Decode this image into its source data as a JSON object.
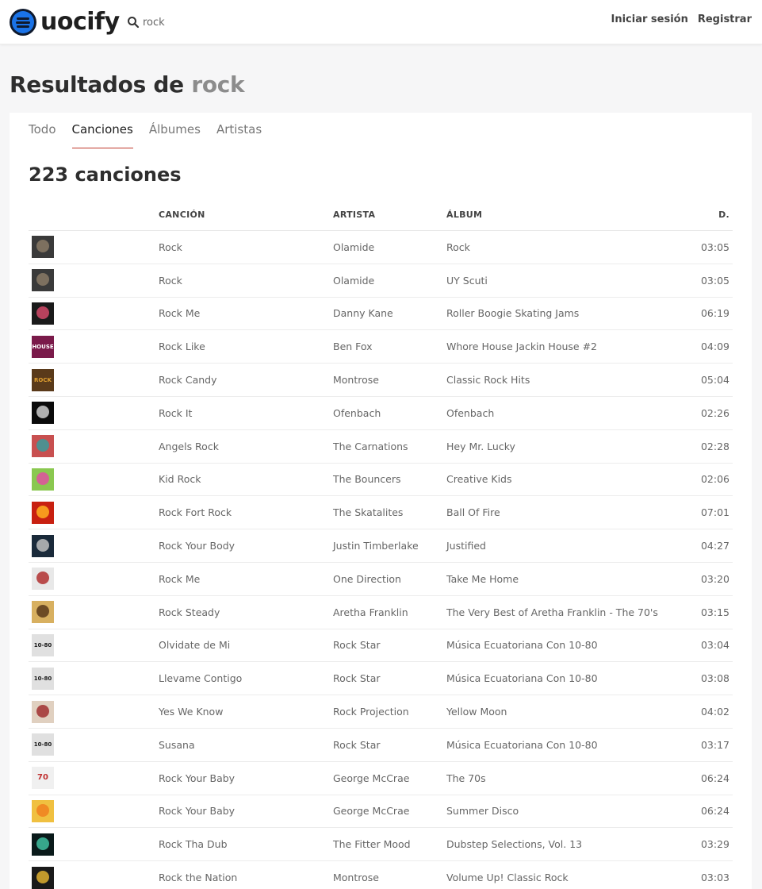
{
  "header": {
    "logo_text": "uocify",
    "search_value": "rock",
    "login_label": "Iniciar sesión",
    "register_label": "Registrar"
  },
  "page": {
    "title_prefix": "Resultados de",
    "title_query": "rock"
  },
  "tabs": [
    {
      "label": "Todo",
      "active": false
    },
    {
      "label": "Canciones",
      "active": true
    },
    {
      "label": "Álbumes",
      "active": false
    },
    {
      "label": "Artistas",
      "active": false
    }
  ],
  "results": {
    "count_label": "223 canciones",
    "columns": {
      "song": "CANCIÓN",
      "artist": "ARTISTA",
      "album": "ÁLBUM",
      "duration": "D."
    },
    "rows": [
      {
        "song": "Rock",
        "artist": "Olamide",
        "album": "Rock",
        "duration": "03:05",
        "art": {
          "bg": "#3a3a3a",
          "fg": "#8a7a66",
          "text": ""
        }
      },
      {
        "song": "Rock",
        "artist": "Olamide",
        "album": "UY Scuti",
        "duration": "03:05",
        "art": {
          "bg": "#3a3a3a",
          "fg": "#8a7a66",
          "text": ""
        }
      },
      {
        "song": "Rock Me",
        "artist": "Danny Kane",
        "album": "Roller Boogie Skating Jams",
        "duration": "06:19",
        "art": {
          "bg": "#1a1a1a",
          "fg": "#d44a6a",
          "text": ""
        }
      },
      {
        "song": "Rock Like",
        "artist": "Ben Fox",
        "album": "Whore House Jackin House #2",
        "duration": "04:09",
        "art": {
          "bg": "#7a1a4a",
          "fg": "#ffffff",
          "text": "HOUSE"
        }
      },
      {
        "song": "Rock Candy",
        "artist": "Montrose",
        "album": "Classic Rock Hits",
        "duration": "05:04",
        "art": {
          "bg": "#5a3a1a",
          "fg": "#e0a030",
          "text": "ROCK"
        }
      },
      {
        "song": "Rock It",
        "artist": "Ofenbach",
        "album": "Ofenbach",
        "duration": "02:26",
        "art": {
          "bg": "#0a0a0a",
          "fg": "#cccccc",
          "text": ""
        }
      },
      {
        "song": "Angels Rock",
        "artist": "The Carnations",
        "album": "Hey Mr. Lucky",
        "duration": "02:28",
        "art": {
          "bg": "#c85050",
          "fg": "#3a9a9a",
          "text": ""
        }
      },
      {
        "song": "Kid Rock",
        "artist": "The Bouncers",
        "album": "Creative Kids",
        "duration": "02:06",
        "art": {
          "bg": "#8ac850",
          "fg": "#e050a0",
          "text": ""
        }
      },
      {
        "song": "Rock Fort Rock",
        "artist": "The Skatalites",
        "album": "Ball Of Fire",
        "duration": "07:01",
        "art": {
          "bg": "#c82010",
          "fg": "#ffb020",
          "text": ""
        }
      },
      {
        "song": "Rock Your Body",
        "artist": "Justin Timberlake",
        "album": "Justified",
        "duration": "04:27",
        "art": {
          "bg": "#1a2a3a",
          "fg": "#c0c0c0",
          "text": ""
        }
      },
      {
        "song": "Rock Me",
        "artist": "One Direction",
        "album": "Take Me Home",
        "duration": "03:20",
        "art": {
          "bg": "#e8e8e8",
          "fg": "#b03030",
          "text": ""
        }
      },
      {
        "song": "Rock Steady",
        "artist": "Aretha Franklin",
        "album": "The Very Best of Aretha Franklin - The 70's",
        "duration": "03:15",
        "art": {
          "bg": "#d8b060",
          "fg": "#5a3a1a",
          "text": ""
        }
      },
      {
        "song": "Olvidate de Mi",
        "artist": "Rock Star",
        "album": "Música Ecuatoriana Con 10-80",
        "duration": "03:04",
        "art": {
          "bg": "#e0e0e0",
          "fg": "#1a1a1a",
          "text": "10-80"
        }
      },
      {
        "song": "Llevame Contigo",
        "artist": "Rock Star",
        "album": "Música Ecuatoriana Con 10-80",
        "duration": "03:08",
        "art": {
          "bg": "#e0e0e0",
          "fg": "#1a1a1a",
          "text": "10-80"
        }
      },
      {
        "song": "Yes We Know",
        "artist": "Rock Projection",
        "album": "Yellow Moon",
        "duration": "04:02",
        "art": {
          "bg": "#e0d0c0",
          "fg": "#a03030",
          "text": ""
        }
      },
      {
        "song": "Susana",
        "artist": "Rock Star",
        "album": "Música Ecuatoriana Con 10-80",
        "duration": "03:17",
        "art": {
          "bg": "#e0e0e0",
          "fg": "#1a1a1a",
          "text": "10-80"
        }
      },
      {
        "song": "Rock Your Baby",
        "artist": "George McCrae",
        "album": "The 70s",
        "duration": "06:24",
        "art": {
          "bg": "#f0f0f0",
          "fg": "#c03030",
          "text": "70"
        }
      },
      {
        "song": "Rock Your Baby",
        "artist": "George McCrae",
        "album": "Summer Disco",
        "duration": "06:24",
        "art": {
          "bg": "#f0c040",
          "fg": "#f08020",
          "text": ""
        }
      },
      {
        "song": "Rock Tha Dub",
        "artist": "The Fitter Mood",
        "album": "Dubstep Selections, Vol. 13",
        "duration": "03:29",
        "art": {
          "bg": "#0a1a1a",
          "fg": "#40c0a0",
          "text": ""
        }
      },
      {
        "song": "Rock the Nation",
        "artist": "Montrose",
        "album": "Volume Up! Classic Rock",
        "duration": "03:03",
        "art": {
          "bg": "#1a1a1a",
          "fg": "#e0b030",
          "text": ""
        }
      }
    ]
  }
}
